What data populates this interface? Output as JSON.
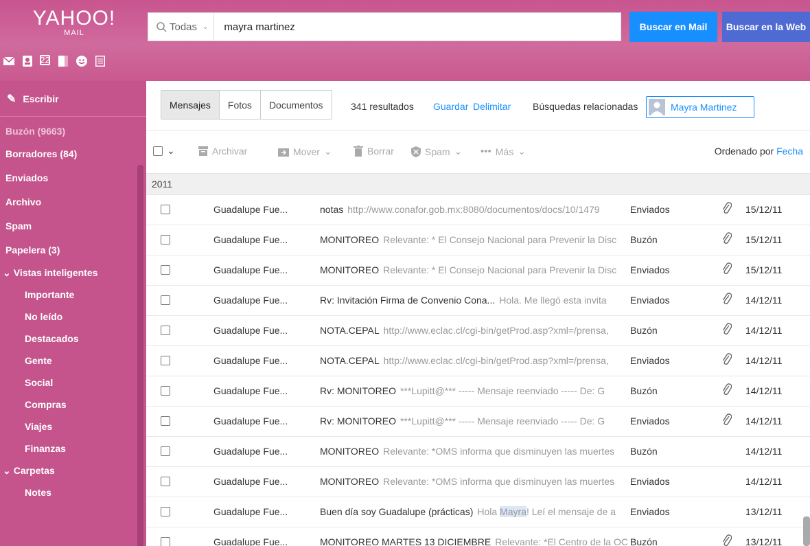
{
  "header": {
    "logo_main": "YAHOO!",
    "logo_sub": "MAIL",
    "apps": [
      "mail-icon",
      "contacts-icon",
      "calendar-icon",
      "notepad-icon",
      "messenger-icon",
      "newsfeed-icon"
    ],
    "calendar_day": "22",
    "search": {
      "scope": "Todas",
      "query": "mayra martinez",
      "btn_mail": "Buscar en Mail",
      "btn_web": "Buscar en la Web"
    }
  },
  "sidebar": {
    "compose": "Escribir",
    "folders": [
      {
        "label": "Buzón (9663)"
      },
      {
        "label": "Borradores (84)"
      },
      {
        "label": "Enviados"
      },
      {
        "label": "Archivo"
      },
      {
        "label": "Spam"
      },
      {
        "label": "Papelera (3)"
      }
    ],
    "smart_views_title": "Vistas inteligentes",
    "smart_views": [
      "Importante",
      "No leído",
      "Destacados",
      "Gente",
      "Social",
      "Compras",
      "Viajes",
      "Finanzas"
    ],
    "folders_title": "Carpetas",
    "custom_folders": [
      "Notes"
    ]
  },
  "main": {
    "tabs": [
      "Mensajes",
      "Fotos",
      "Documentos"
    ],
    "results": "341 resultados",
    "save": "Guardar",
    "refine": "Delimitar",
    "related": "Búsquedas relacionadas",
    "related_person": "Mayra Martinez",
    "toolbar": {
      "archive": "Archivar",
      "move": "Mover",
      "delete": "Borrar",
      "spam": "Spam",
      "more": "Más",
      "sort_prefix": "Ordenado por",
      "sort_field": "Fecha"
    },
    "year": "2011",
    "messages": [
      {
        "from": "Guadalupe Fue...",
        "subject": "notas",
        "preview": "http://www.conafor.gob.mx:8080/documentos/docs/10/1479",
        "folder": "Enviados",
        "attachment": true,
        "date": "15/12/11"
      },
      {
        "from": "Guadalupe Fue...",
        "subject": "MONITOREO",
        "preview": "Relevante: * El Consejo Nacional para Prevenir la Disc",
        "folder": "Buzón",
        "attachment": true,
        "date": "15/12/11"
      },
      {
        "from": "Guadalupe Fue...",
        "subject": "MONITOREO",
        "preview": "Relevante: * El Consejo Nacional para Prevenir la Disc",
        "folder": "Enviados",
        "attachment": true,
        "date": "15/12/11"
      },
      {
        "from": "Guadalupe Fue...",
        "subject": "Rv: Invitación Firma de Convenio Cona...",
        "preview": "Hola. Me llegó esta invita",
        "folder": "Enviados",
        "attachment": true,
        "date": "14/12/11"
      },
      {
        "from": "Guadalupe Fue...",
        "subject": "NOTA.CEPAL",
        "preview": "http://www.eclac.cl/cgi-bin/getProd.asp?xml=/prensa,",
        "folder": "Buzón",
        "attachment": true,
        "date": "14/12/11"
      },
      {
        "from": "Guadalupe Fue...",
        "subject": "NOTA.CEPAL",
        "preview": "http://www.eclac.cl/cgi-bin/getProd.asp?xml=/prensa,",
        "folder": "Enviados",
        "attachment": true,
        "date": "14/12/11"
      },
      {
        "from": "Guadalupe Fue...",
        "subject": "Rv: MONITOREO",
        "preview": "***Lupitt@*** ----- Mensaje reenviado ----- De: G",
        "folder": "Buzón",
        "attachment": true,
        "date": "14/12/11"
      },
      {
        "from": "Guadalupe Fue...",
        "subject": "Rv: MONITOREO",
        "preview": "***Lupitt@*** ----- Mensaje reenviado ----- De: G",
        "folder": "Enviados",
        "attachment": true,
        "date": "14/12/11"
      },
      {
        "from": "Guadalupe Fue...",
        "subject": "MONITOREO",
        "preview": "Relevante: *OMS informa que disminuyen las muertes",
        "folder": "Buzón",
        "attachment": false,
        "date": "14/12/11"
      },
      {
        "from": "Guadalupe Fue...",
        "subject": "MONITOREO",
        "preview": "Relevante: *OMS informa que disminuyen las muertes",
        "folder": "Enviados",
        "attachment": false,
        "date": "14/12/11"
      },
      {
        "from": "Guadalupe Fue...",
        "subject": "Buen día soy Guadalupe (prácticas)",
        "preview_before": "Hola",
        "preview_highlight": "Mayra",
        "preview_after": "! Leí el mensaje de a",
        "folder": "Enviados",
        "attachment": false,
        "date": "13/12/11"
      },
      {
        "from": "Guadalupe Fue...",
        "subject": "MONITOREO MARTES 13 DICIEMBRE",
        "preview": "Relevante: *El Centro de la OC",
        "folder": "Buzón",
        "attachment": true,
        "date": "13/12/11"
      }
    ]
  },
  "colors": {
    "brand": "#c5548c",
    "accent_blue": "#188fff",
    "web_button": "#4f6bd3"
  }
}
